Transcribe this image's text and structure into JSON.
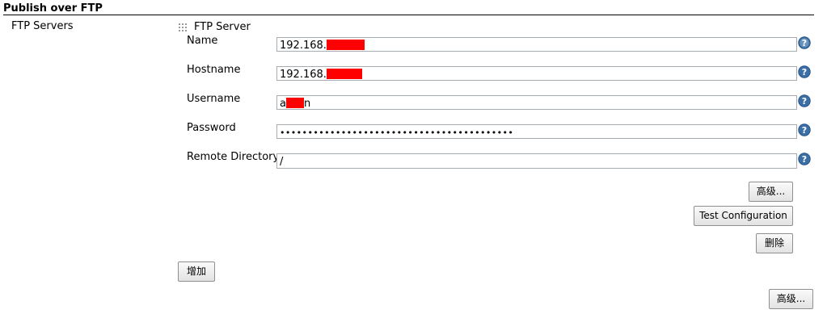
{
  "section": {
    "title": "Publish over FTP"
  },
  "ftp_servers_label": "FTP Servers",
  "server": {
    "title": "FTP Server",
    "fields": {
      "name": {
        "label": "Name",
        "value": "192.168."
      },
      "hostname": {
        "label": "Hostname",
        "value": "192.168."
      },
      "username": {
        "label": "Username",
        "value_start": "a",
        "value_end": "n"
      },
      "password": {
        "label": "Password",
        "value": "••••••••••••••••••••••••••••••••••••••••••"
      },
      "remote_directory": {
        "label": "Remote Directory",
        "value": "/"
      }
    },
    "advanced_button": "高级...",
    "test_button": "Test Configuration",
    "delete_button": "删除"
  },
  "add_button": "增加",
  "section_advanced_button": "高级...",
  "colors": {
    "redaction": "#ff0000",
    "help_icon": "#3a6ea5"
  },
  "icons": {
    "help": "help-icon",
    "drag": "drag-handle-icon"
  }
}
